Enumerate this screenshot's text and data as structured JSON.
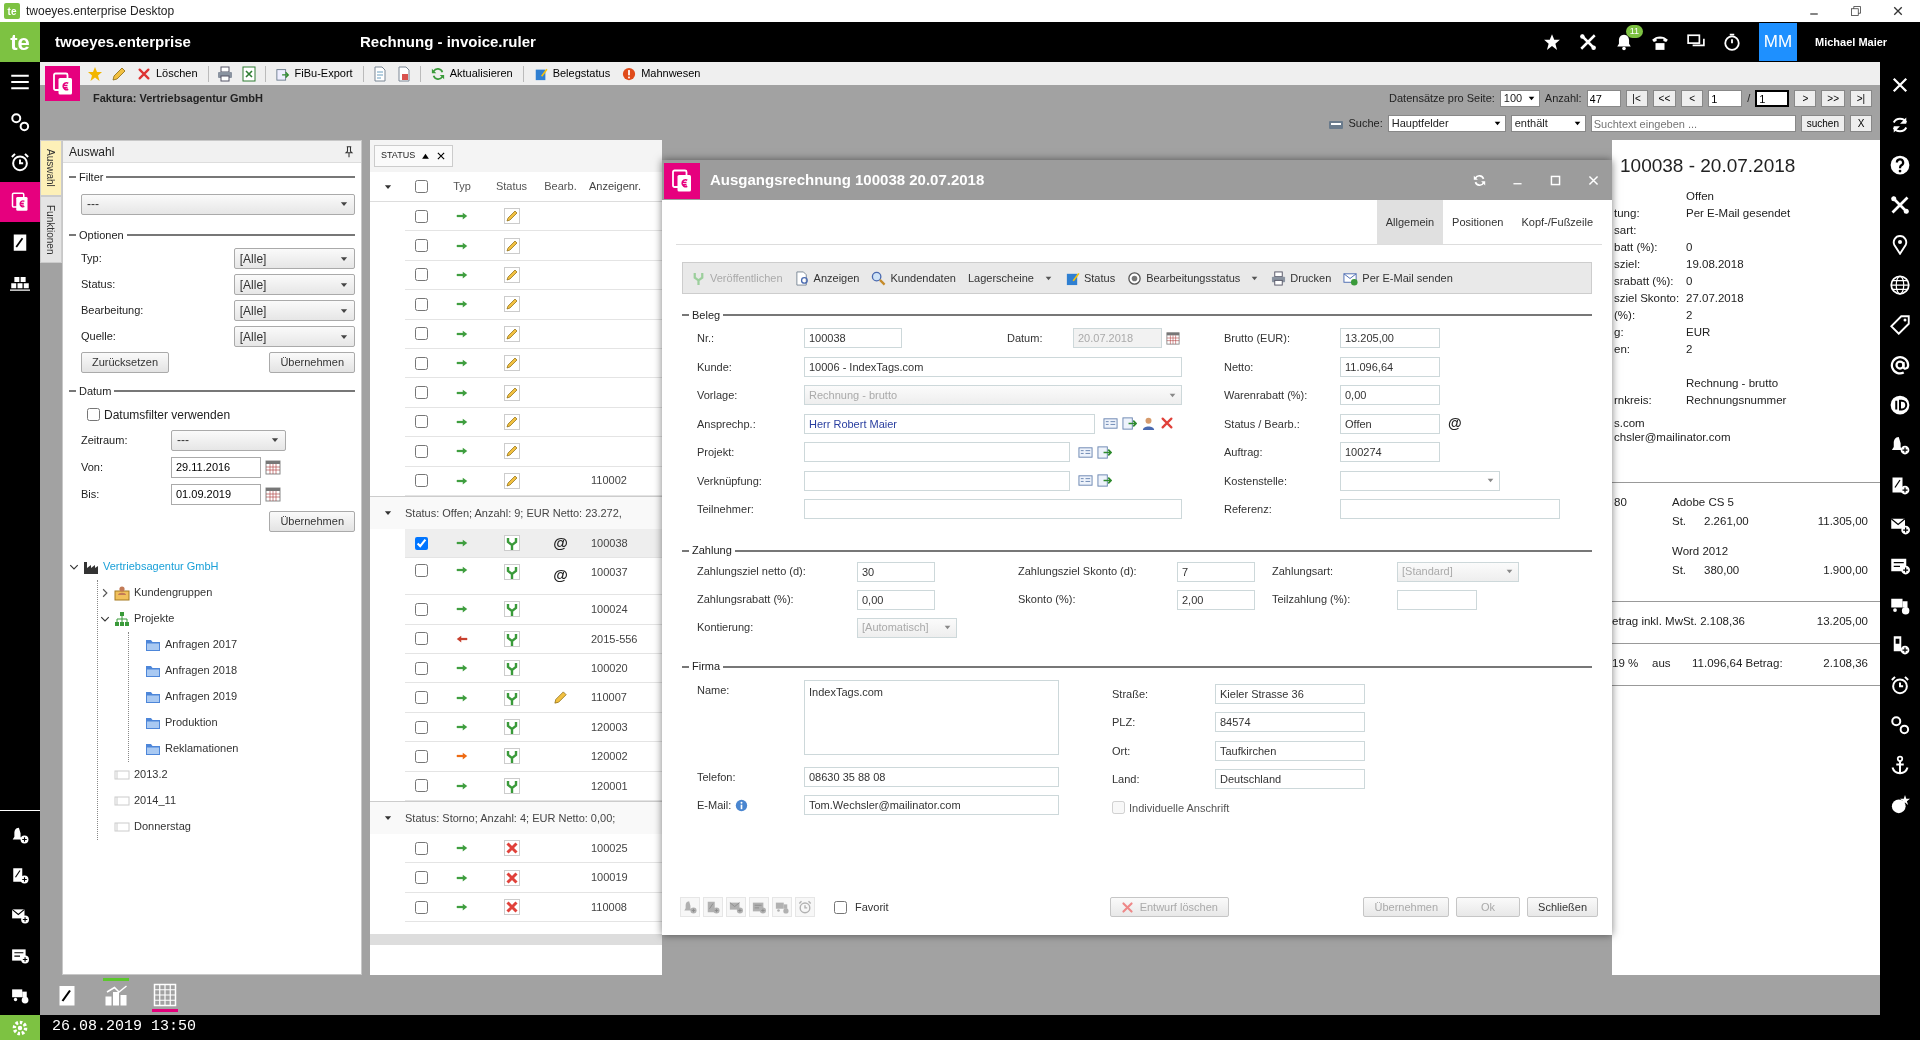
{
  "title_bar": {
    "logo": "te",
    "title": "twoeyes.enterprise Desktop"
  },
  "app_bar": {
    "logo": "te",
    "brand": "twoeyes.enterprise",
    "title": "Rechnung - invoice.ruler",
    "notification_count": "11",
    "user_initials": "MM",
    "user_name": "Michael Maier"
  },
  "left_nav": {
    "top": [
      {
        "selected": false
      },
      {
        "selected": false
      },
      {
        "selected": false
      },
      {
        "selected": true
      },
      {
        "selected": false
      },
      {
        "selected": false
      }
    ],
    "bottom": [
      {
        "selected": false
      },
      {
        "selected": false
      },
      {
        "selected": false
      },
      {
        "selected": false
      },
      {
        "selected": false
      }
    ]
  },
  "toolbar": {
    "delete": "Löschen",
    "export": "FiBu-Export",
    "refresh": "Aktualisieren",
    "doc_status": "Belegstatus",
    "dunning": "Mahnwesen"
  },
  "context": {
    "title": "Faktura: Vertriebsagentur GmbH"
  },
  "pager": {
    "per_page_label": "Datensätze pro Seite:",
    "per_page": "100",
    "count_label": "Anzahl:",
    "count": "47",
    "first": "|<",
    "prev_fast": "<<",
    "prev": "<",
    "page": "1",
    "separator": "/",
    "pages": "1",
    "next": ">",
    "next_fast": ">>",
    "last": ">|"
  },
  "search": {
    "label": "Suche:",
    "field": "Hauptfelder",
    "operator": "enthält",
    "placeholder": "Suchtext eingeben ...",
    "button": "suchen",
    "clear": "X"
  },
  "side_tabs": [
    {
      "label": "Auswahl",
      "selected": true
    },
    {
      "label": "Funktionen",
      "selected": false
    }
  ],
  "selection_panel": {
    "title": "Auswahl",
    "filter": {
      "title": "Filter",
      "value": "---"
    },
    "options": {
      "title": "Optionen",
      "fields": [
        {
          "label": "Typ:",
          "value": "[Alle]"
        },
        {
          "label": "Status:",
          "value": "[Alle]"
        },
        {
          "label": "Bearbeitung:",
          "value": "[Alle]"
        },
        {
          "label": "Quelle:",
          "value": "[Alle]"
        }
      ],
      "buttons": [
        "Zurücksetzen",
        "Übernehmen"
      ]
    },
    "date": {
      "title": "Datum",
      "use_filter": {
        "label": "Datumsfilter verwenden",
        "checked": false
      },
      "fields": [
        {
          "label": "Zeitraum:",
          "value": "---",
          "kind": "select"
        },
        {
          "label": "Von:",
          "value": "29.11.2016",
          "kind": "date"
        },
        {
          "label": "Bis:",
          "value": "01.09.2019",
          "kind": "date"
        }
      ],
      "button": "Übernehmen"
    },
    "tree": [
      {
        "label": "Vertriebsagentur GmbH",
        "kind": "company",
        "selected": true,
        "expanded": true,
        "children": [
          {
            "label": "Kundengruppen",
            "kind": "group",
            "selected": false,
            "expanded": false
          },
          {
            "label": "Projekte",
            "kind": "projects",
            "selected": false,
            "expanded": true,
            "children": [
              {
                "label": "Anfragen 2017",
                "kind": "folder",
                "selected": false
              },
              {
                "label": "Anfragen 2018",
                "kind": "folder",
                "selected": false
              },
              {
                "label": "Anfragen 2019",
                "kind": "folder",
                "selected": false
              },
              {
                "label": "Produktion",
                "kind": "folder",
                "selected": false
              },
              {
                "label": "Reklamationen",
                "kind": "folder",
                "selected": false
              }
            ]
          },
          {
            "label": "2013.2",
            "kind": "plain",
            "selected": false
          },
          {
            "label": "2014_11",
            "kind": "plain",
            "selected": false
          },
          {
            "label": "Donnerstag",
            "kind": "plain",
            "selected": false
          }
        ]
      }
    ]
  },
  "bottom_tabs": [
    {
      "kind": "plain"
    },
    {
      "kind": "topmarked",
      "color": "#5cc72e"
    },
    {
      "kind": "bottommarked",
      "color": "#e3007b"
    }
  ],
  "status_bar": {
    "datetime": "26.08.2019 13:50"
  },
  "list": {
    "group_chip": "STATUS",
    "select_all": false,
    "columns": [
      "Typ",
      "Status",
      "Bearb.",
      "Anzeigenr."
    ],
    "groups": [
      {
        "rows": [
          {
            "incoming": false,
            "color": "#3f9e3f",
            "kind": "draft",
            "edited": false,
            "checked": false,
            "selected": false
          },
          {
            "incoming": false,
            "color": "#3f9e3f",
            "kind": "draft",
            "edited": false,
            "checked": false,
            "selected": false
          },
          {
            "incoming": false,
            "color": "#3f9e3f",
            "kind": "draft",
            "edited": false,
            "checked": false,
            "selected": false
          },
          {
            "incoming": false,
            "color": "#3f9e3f",
            "kind": "draft",
            "edited": false,
            "checked": false,
            "selected": false
          },
          {
            "incoming": false,
            "color": "#3f9e3f",
            "kind": "draft",
            "edited": false,
            "checked": false,
            "selected": false
          },
          {
            "incoming": false,
            "color": "#3f9e3f",
            "kind": "draft",
            "edited": false,
            "checked": false,
            "selected": false
          },
          {
            "incoming": false,
            "color": "#3f9e3f",
            "kind": "draft",
            "edited": false,
            "checked": false,
            "selected": false
          },
          {
            "incoming": false,
            "color": "#3f9e3f",
            "kind": "draft",
            "edited": false,
            "checked": false,
            "selected": false
          },
          {
            "incoming": false,
            "color": "#3f9e3f",
            "kind": "draft",
            "edited": false,
            "checked": false,
            "selected": false
          },
          {
            "incoming": false,
            "color": "#3f9e3f",
            "kind": "draft",
            "edited": false,
            "number": "110002",
            "checked": false,
            "selected": false
          }
        ]
      },
      {
        "header": "Status: Offen; Anzahl: 9; EUR Netto: 23.272,",
        "expanded": true,
        "rows": [
          {
            "incoming": false,
            "color": "#3f9e3f",
            "kind": "published",
            "bearb": "@",
            "edited": false,
            "number": "100038",
            "checked": true,
            "selected": true
          },
          {
            "incoming": false,
            "color": "#3f9e3f",
            "kind": "published",
            "bearb": "@",
            "edited": false,
            "number": "100037",
            "checked": false,
            "selected": false
          },
          {
            "incoming": false,
            "color": "#3f9e3f",
            "kind": "published",
            "edited": false,
            "number": "100024",
            "checked": false,
            "selected": false
          },
          {
            "incoming": true,
            "color": "#c8402e",
            "kind": "published",
            "edited": false,
            "number": "2015-556",
            "checked": false,
            "selected": false
          },
          {
            "incoming": false,
            "color": "#3f9e3f",
            "kind": "published",
            "edited": false,
            "number": "100020",
            "checked": false,
            "selected": false
          },
          {
            "incoming": false,
            "color": "#3f9e3f",
            "kind": "published",
            "edited": true,
            "number": "110007",
            "checked": false,
            "selected": false
          },
          {
            "incoming": false,
            "color": "#3f9e3f",
            "kind": "published",
            "edited": false,
            "number": "120003",
            "checked": false,
            "selected": false
          },
          {
            "incoming": false,
            "color": "#ee6a12",
            "kind": "published",
            "edited": false,
            "number": "120002",
            "checked": false,
            "selected": false
          },
          {
            "incoming": false,
            "color": "#3f9e3f",
            "kind": "published",
            "edited": false,
            "number": "120001",
            "checked": false,
            "selected": false
          }
        ]
      },
      {
        "header": "Status: Storno; Anzahl: 4; EUR Netto: 0,00;",
        "expanded": true,
        "rows": [
          {
            "incoming": false,
            "color": "#3f9e3f",
            "kind": "cancelled",
            "edited": false,
            "number": "100025",
            "checked": false,
            "selected": false
          },
          {
            "incoming": false,
            "color": "#3f9e3f",
            "kind": "cancelled",
            "edited": false,
            "number": "100019",
            "checked": false,
            "selected": false
          },
          {
            "incoming": false,
            "color": "#3f9e3f",
            "kind": "cancelled",
            "edited": false,
            "number": "110008",
            "checked": false,
            "selected": false
          }
        ]
      }
    ]
  },
  "dialog": {
    "title": "Ausgangsrechnung 100038 20.07.2018",
    "tabs": [
      {
        "label": "Allgemein",
        "selected": true
      },
      {
        "label": "Positionen",
        "selected": false
      },
      {
        "label": "Kopf-/Fußzeile",
        "selected": false
      }
    ],
    "toolbar": [
      {
        "label": "Veröffentlichen",
        "disabled": true,
        "dropdown": false
      },
      {
        "label": "Anzeigen",
        "disabled": false,
        "dropdown": false
      },
      {
        "label": "Kundendaten",
        "disabled": false,
        "dropdown": false
      },
      {
        "label": "Lagerscheine",
        "disabled": false,
        "dropdown": true
      },
      {
        "label": "Status",
        "disabled": false,
        "dropdown": false
      },
      {
        "label": "Bearbeitungsstatus",
        "disabled": false,
        "dropdown": true
      },
      {
        "label": "Drucken",
        "disabled": false,
        "dropdown": false
      },
      {
        "label": "Per E-Mail senden",
        "disabled": false,
        "dropdown": false
      }
    ],
    "beleg": {
      "title": "Beleg",
      "left": [
        {
          "label": "Nr.:",
          "value": "100038",
          "kind": "short",
          "disabled": false
        },
        {
          "label": "Kunde:",
          "value": "10006 - IndexTags.com",
          "kind": "text",
          "disabled": false
        },
        {
          "label": "Vorlage:",
          "value": "Rechnung - brutto",
          "kind": "select",
          "disabled": true
        },
        {
          "label": "Ansprechp.:",
          "value": "Herr Robert Maier",
          "kind": "contact",
          "disabled": false
        },
        {
          "label": "Projekt:",
          "kind": "lookup",
          "disabled": false
        },
        {
          "label": "Verknüpfung:",
          "kind": "lookup",
          "disabled": false
        },
        {
          "label": "Teilnehmer:",
          "kind": "text",
          "disabled": false
        }
      ],
      "date": {
        "label": "Datum:",
        "value": "20.07.2018",
        "disabled": true
      },
      "right": [
        {
          "label": "Brutto (EUR):",
          "value": "13.205,00",
          "kind": "text",
          "disabled": false
        },
        {
          "label": "Netto:",
          "value": "11.096,64",
          "kind": "text",
          "disabled": false
        },
        {
          "label": "Warenrabatt (%):",
          "value": "0,00",
          "kind": "text",
          "disabled": false
        },
        {
          "label": "Status / Bearb.:",
          "value": "Offen",
          "kind": "status",
          "suffix": "@",
          "disabled": false
        },
        {
          "label": "Auftrag:",
          "value": "100274",
          "kind": "text",
          "disabled": false
        },
        {
          "label": "Kostenstelle:",
          "kind": "select",
          "disabled": false
        },
        {
          "label": "Referenz:",
          "kind": "wide",
          "disabled": false
        }
      ]
    },
    "zahlung": {
      "title": "Zahlung",
      "rows": [
        [
          {
            "label": "Zahlungsziel netto (d):",
            "value": "30",
            "kind": "text",
            "disabled": false
          },
          {
            "label": "Zahlungsziel Skonto (d):",
            "value": "7",
            "kind": "text",
            "disabled": false
          },
          {
            "label": "Zahlungsart:",
            "value": "[Standard]",
            "kind": "select",
            "disabled": true
          }
        ],
        [
          {
            "label": "Zahlungsrabatt (%):",
            "value": "0,00",
            "kind": "text",
            "disabled": false
          },
          {
            "label": "Skonto (%):",
            "value": "2,00",
            "kind": "text",
            "disabled": false
          },
          {
            "label": "Teilzahlung (%):",
            "kind": "text",
            "disabled": false
          }
        ],
        [
          {
            "label": "Kontierung:",
            "value": "[Automatisch]",
            "kind": "small-select",
            "disabled": true
          }
        ]
      ]
    },
    "firma": {
      "title": "Firma",
      "left": [
        {
          "label": "Name:",
          "value": "IndexTags.com",
          "kind": "textarea"
        },
        {
          "label": "Telefon:",
          "value": "08630 35 88 08",
          "kind": "text"
        },
        {
          "label": "E-Mail:",
          "value": "Tom.Wechsler@mailinator.com",
          "kind": "email"
        }
      ],
      "right": [
        {
          "label": "Straße:",
          "value": "Kieler Strasse 36"
        },
        {
          "label": "PLZ:",
          "value": "84574"
        },
        {
          "label": "Ort:",
          "value": "Taufkirchen"
        },
        {
          "label": "Land:",
          "value": "Deutschland"
        }
      ],
      "individual_address": {
        "label": "Individuelle Anschrift",
        "checked": false,
        "disabled": true
      }
    },
    "footer": {
      "tool_buttons": [
        {
          "disabled": true
        },
        {
          "disabled": true
        },
        {
          "disabled": true
        },
        {
          "disabled": true
        },
        {
          "disabled": true
        },
        {
          "disabled": true
        }
      ],
      "favorite": {
        "label": "Favorit",
        "checked": false
      },
      "buttons": [
        {
          "label": "Entwurf löschen",
          "kind": "delete",
          "disabled": true
        },
        {
          "label": "Übernehmen",
          "kind": "plain",
          "disabled": true
        },
        {
          "label": "Ok",
          "kind": "plain",
          "disabled": true
        },
        {
          "label": "Schließen",
          "kind": "plain",
          "disabled": false
        }
      ]
    }
  },
  "preview": {
    "title": "100038 - 20.07.2018",
    "info_groups": [
      [
        {
          "value": "Offen"
        },
        {
          "label": "tung:",
          "value": "Per E-Mail gesendet"
        },
        {
          "label": "sart:"
        },
        {
          "label": "batt (%):",
          "value": "0"
        },
        {
          "label": "sziel:",
          "value": "19.08.2018"
        },
        {
          "label": "srabatt (%):",
          "value": "0"
        },
        {
          "label": "sziel Skonto:",
          "value": "27.07.2018"
        },
        {
          "label": "(%):",
          "value": "2"
        },
        {
          "label": "g:",
          "value": "EUR"
        },
        {
          "label": "en:",
          "value": "2"
        }
      ],
      [
        {
          "value": "Rechnung - brutto"
        },
        {
          "label": "rnkreis:",
          "value": "Rechnungsnummer"
        }
      ]
    ],
    "address": [
      "s.com",
      "chsler@mailinator.com"
    ],
    "positions": [
      {
        "number": "80",
        "name": "Adobe CS 5",
        "unit": "St.",
        "price": "2.261,00",
        "total": "11.305,00"
      },
      {
        "name": "Word 2012",
        "unit": "St.",
        "price": "380,00",
        "total": "1.900,00"
      }
    ],
    "total": {
      "label": "etrag inkl. MwSt. 2.108,36",
      "value": "13.205,00"
    },
    "vat": {
      "rate": "19 %",
      "word": "aus",
      "base": "11.096,64 Betrag:",
      "amount": "2.108,36"
    }
  }
}
